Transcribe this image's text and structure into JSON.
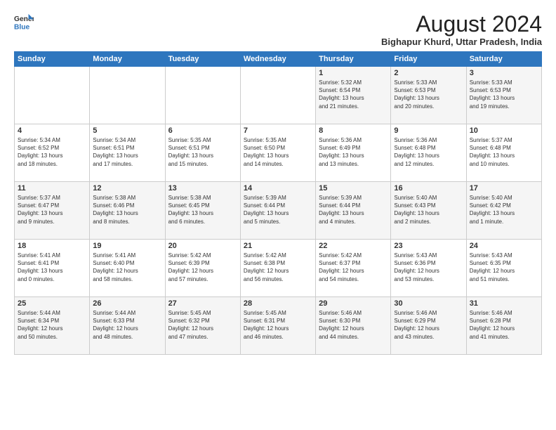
{
  "logo": {
    "line1": "General",
    "line2": "Blue"
  },
  "title": "August 2024",
  "subtitle": "Bighapur Khurd, Uttar Pradesh, India",
  "days_of_week": [
    "Sunday",
    "Monday",
    "Tuesday",
    "Wednesday",
    "Thursday",
    "Friday",
    "Saturday"
  ],
  "weeks": [
    [
      {
        "day": "",
        "info": ""
      },
      {
        "day": "",
        "info": ""
      },
      {
        "day": "",
        "info": ""
      },
      {
        "day": "",
        "info": ""
      },
      {
        "day": "1",
        "info": "Sunrise: 5:32 AM\nSunset: 6:54 PM\nDaylight: 13 hours\nand 21 minutes."
      },
      {
        "day": "2",
        "info": "Sunrise: 5:33 AM\nSunset: 6:53 PM\nDaylight: 13 hours\nand 20 minutes."
      },
      {
        "day": "3",
        "info": "Sunrise: 5:33 AM\nSunset: 6:53 PM\nDaylight: 13 hours\nand 19 minutes."
      }
    ],
    [
      {
        "day": "4",
        "info": "Sunrise: 5:34 AM\nSunset: 6:52 PM\nDaylight: 13 hours\nand 18 minutes."
      },
      {
        "day": "5",
        "info": "Sunrise: 5:34 AM\nSunset: 6:51 PM\nDaylight: 13 hours\nand 17 minutes."
      },
      {
        "day": "6",
        "info": "Sunrise: 5:35 AM\nSunset: 6:51 PM\nDaylight: 13 hours\nand 15 minutes."
      },
      {
        "day": "7",
        "info": "Sunrise: 5:35 AM\nSunset: 6:50 PM\nDaylight: 13 hours\nand 14 minutes."
      },
      {
        "day": "8",
        "info": "Sunrise: 5:36 AM\nSunset: 6:49 PM\nDaylight: 13 hours\nand 13 minutes."
      },
      {
        "day": "9",
        "info": "Sunrise: 5:36 AM\nSunset: 6:48 PM\nDaylight: 13 hours\nand 12 minutes."
      },
      {
        "day": "10",
        "info": "Sunrise: 5:37 AM\nSunset: 6:48 PM\nDaylight: 13 hours\nand 10 minutes."
      }
    ],
    [
      {
        "day": "11",
        "info": "Sunrise: 5:37 AM\nSunset: 6:47 PM\nDaylight: 13 hours\nand 9 minutes."
      },
      {
        "day": "12",
        "info": "Sunrise: 5:38 AM\nSunset: 6:46 PM\nDaylight: 13 hours\nand 8 minutes."
      },
      {
        "day": "13",
        "info": "Sunrise: 5:38 AM\nSunset: 6:45 PM\nDaylight: 13 hours\nand 6 minutes."
      },
      {
        "day": "14",
        "info": "Sunrise: 5:39 AM\nSunset: 6:44 PM\nDaylight: 13 hours\nand 5 minutes."
      },
      {
        "day": "15",
        "info": "Sunrise: 5:39 AM\nSunset: 6:44 PM\nDaylight: 13 hours\nand 4 minutes."
      },
      {
        "day": "16",
        "info": "Sunrise: 5:40 AM\nSunset: 6:43 PM\nDaylight: 13 hours\nand 2 minutes."
      },
      {
        "day": "17",
        "info": "Sunrise: 5:40 AM\nSunset: 6:42 PM\nDaylight: 13 hours\nand 1 minute."
      }
    ],
    [
      {
        "day": "18",
        "info": "Sunrise: 5:41 AM\nSunset: 6:41 PM\nDaylight: 13 hours\nand 0 minutes."
      },
      {
        "day": "19",
        "info": "Sunrise: 5:41 AM\nSunset: 6:40 PM\nDaylight: 12 hours\nand 58 minutes."
      },
      {
        "day": "20",
        "info": "Sunrise: 5:42 AM\nSunset: 6:39 PM\nDaylight: 12 hours\nand 57 minutes."
      },
      {
        "day": "21",
        "info": "Sunrise: 5:42 AM\nSunset: 6:38 PM\nDaylight: 12 hours\nand 56 minutes."
      },
      {
        "day": "22",
        "info": "Sunrise: 5:42 AM\nSunset: 6:37 PM\nDaylight: 12 hours\nand 54 minutes."
      },
      {
        "day": "23",
        "info": "Sunrise: 5:43 AM\nSunset: 6:36 PM\nDaylight: 12 hours\nand 53 minutes."
      },
      {
        "day": "24",
        "info": "Sunrise: 5:43 AM\nSunset: 6:35 PM\nDaylight: 12 hours\nand 51 minutes."
      }
    ],
    [
      {
        "day": "25",
        "info": "Sunrise: 5:44 AM\nSunset: 6:34 PM\nDaylight: 12 hours\nand 50 minutes."
      },
      {
        "day": "26",
        "info": "Sunrise: 5:44 AM\nSunset: 6:33 PM\nDaylight: 12 hours\nand 48 minutes."
      },
      {
        "day": "27",
        "info": "Sunrise: 5:45 AM\nSunset: 6:32 PM\nDaylight: 12 hours\nand 47 minutes."
      },
      {
        "day": "28",
        "info": "Sunrise: 5:45 AM\nSunset: 6:31 PM\nDaylight: 12 hours\nand 46 minutes."
      },
      {
        "day": "29",
        "info": "Sunrise: 5:46 AM\nSunset: 6:30 PM\nDaylight: 12 hours\nand 44 minutes."
      },
      {
        "day": "30",
        "info": "Sunrise: 5:46 AM\nSunset: 6:29 PM\nDaylight: 12 hours\nand 43 minutes."
      },
      {
        "day": "31",
        "info": "Sunrise: 5:46 AM\nSunset: 6:28 PM\nDaylight: 12 hours\nand 41 minutes."
      }
    ]
  ]
}
